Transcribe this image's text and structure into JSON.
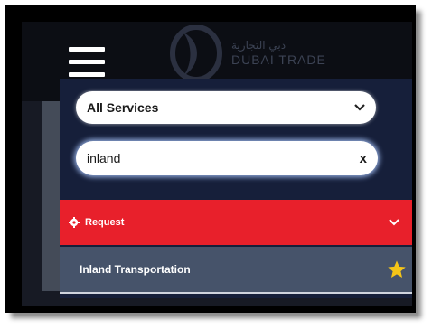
{
  "header": {
    "logo_arabic": "دبي التجارية",
    "logo_english": "DUBAI TRADE"
  },
  "filter": {
    "selected_category": "All Services"
  },
  "search": {
    "value": "inland",
    "clear_label": "x"
  },
  "results": {
    "group_label": "Request",
    "items": [
      {
        "label": "Inland Transportation",
        "favorite": true
      }
    ]
  },
  "colors": {
    "request_bar": "#e8202b",
    "result_row": "#46536a",
    "panel": "#161f3a",
    "star": "#f5c518"
  },
  "icons": {
    "menu": "hamburger-icon",
    "group": "gear-icon",
    "dropdown": "chevron-down-icon",
    "favorite": "star-icon"
  }
}
